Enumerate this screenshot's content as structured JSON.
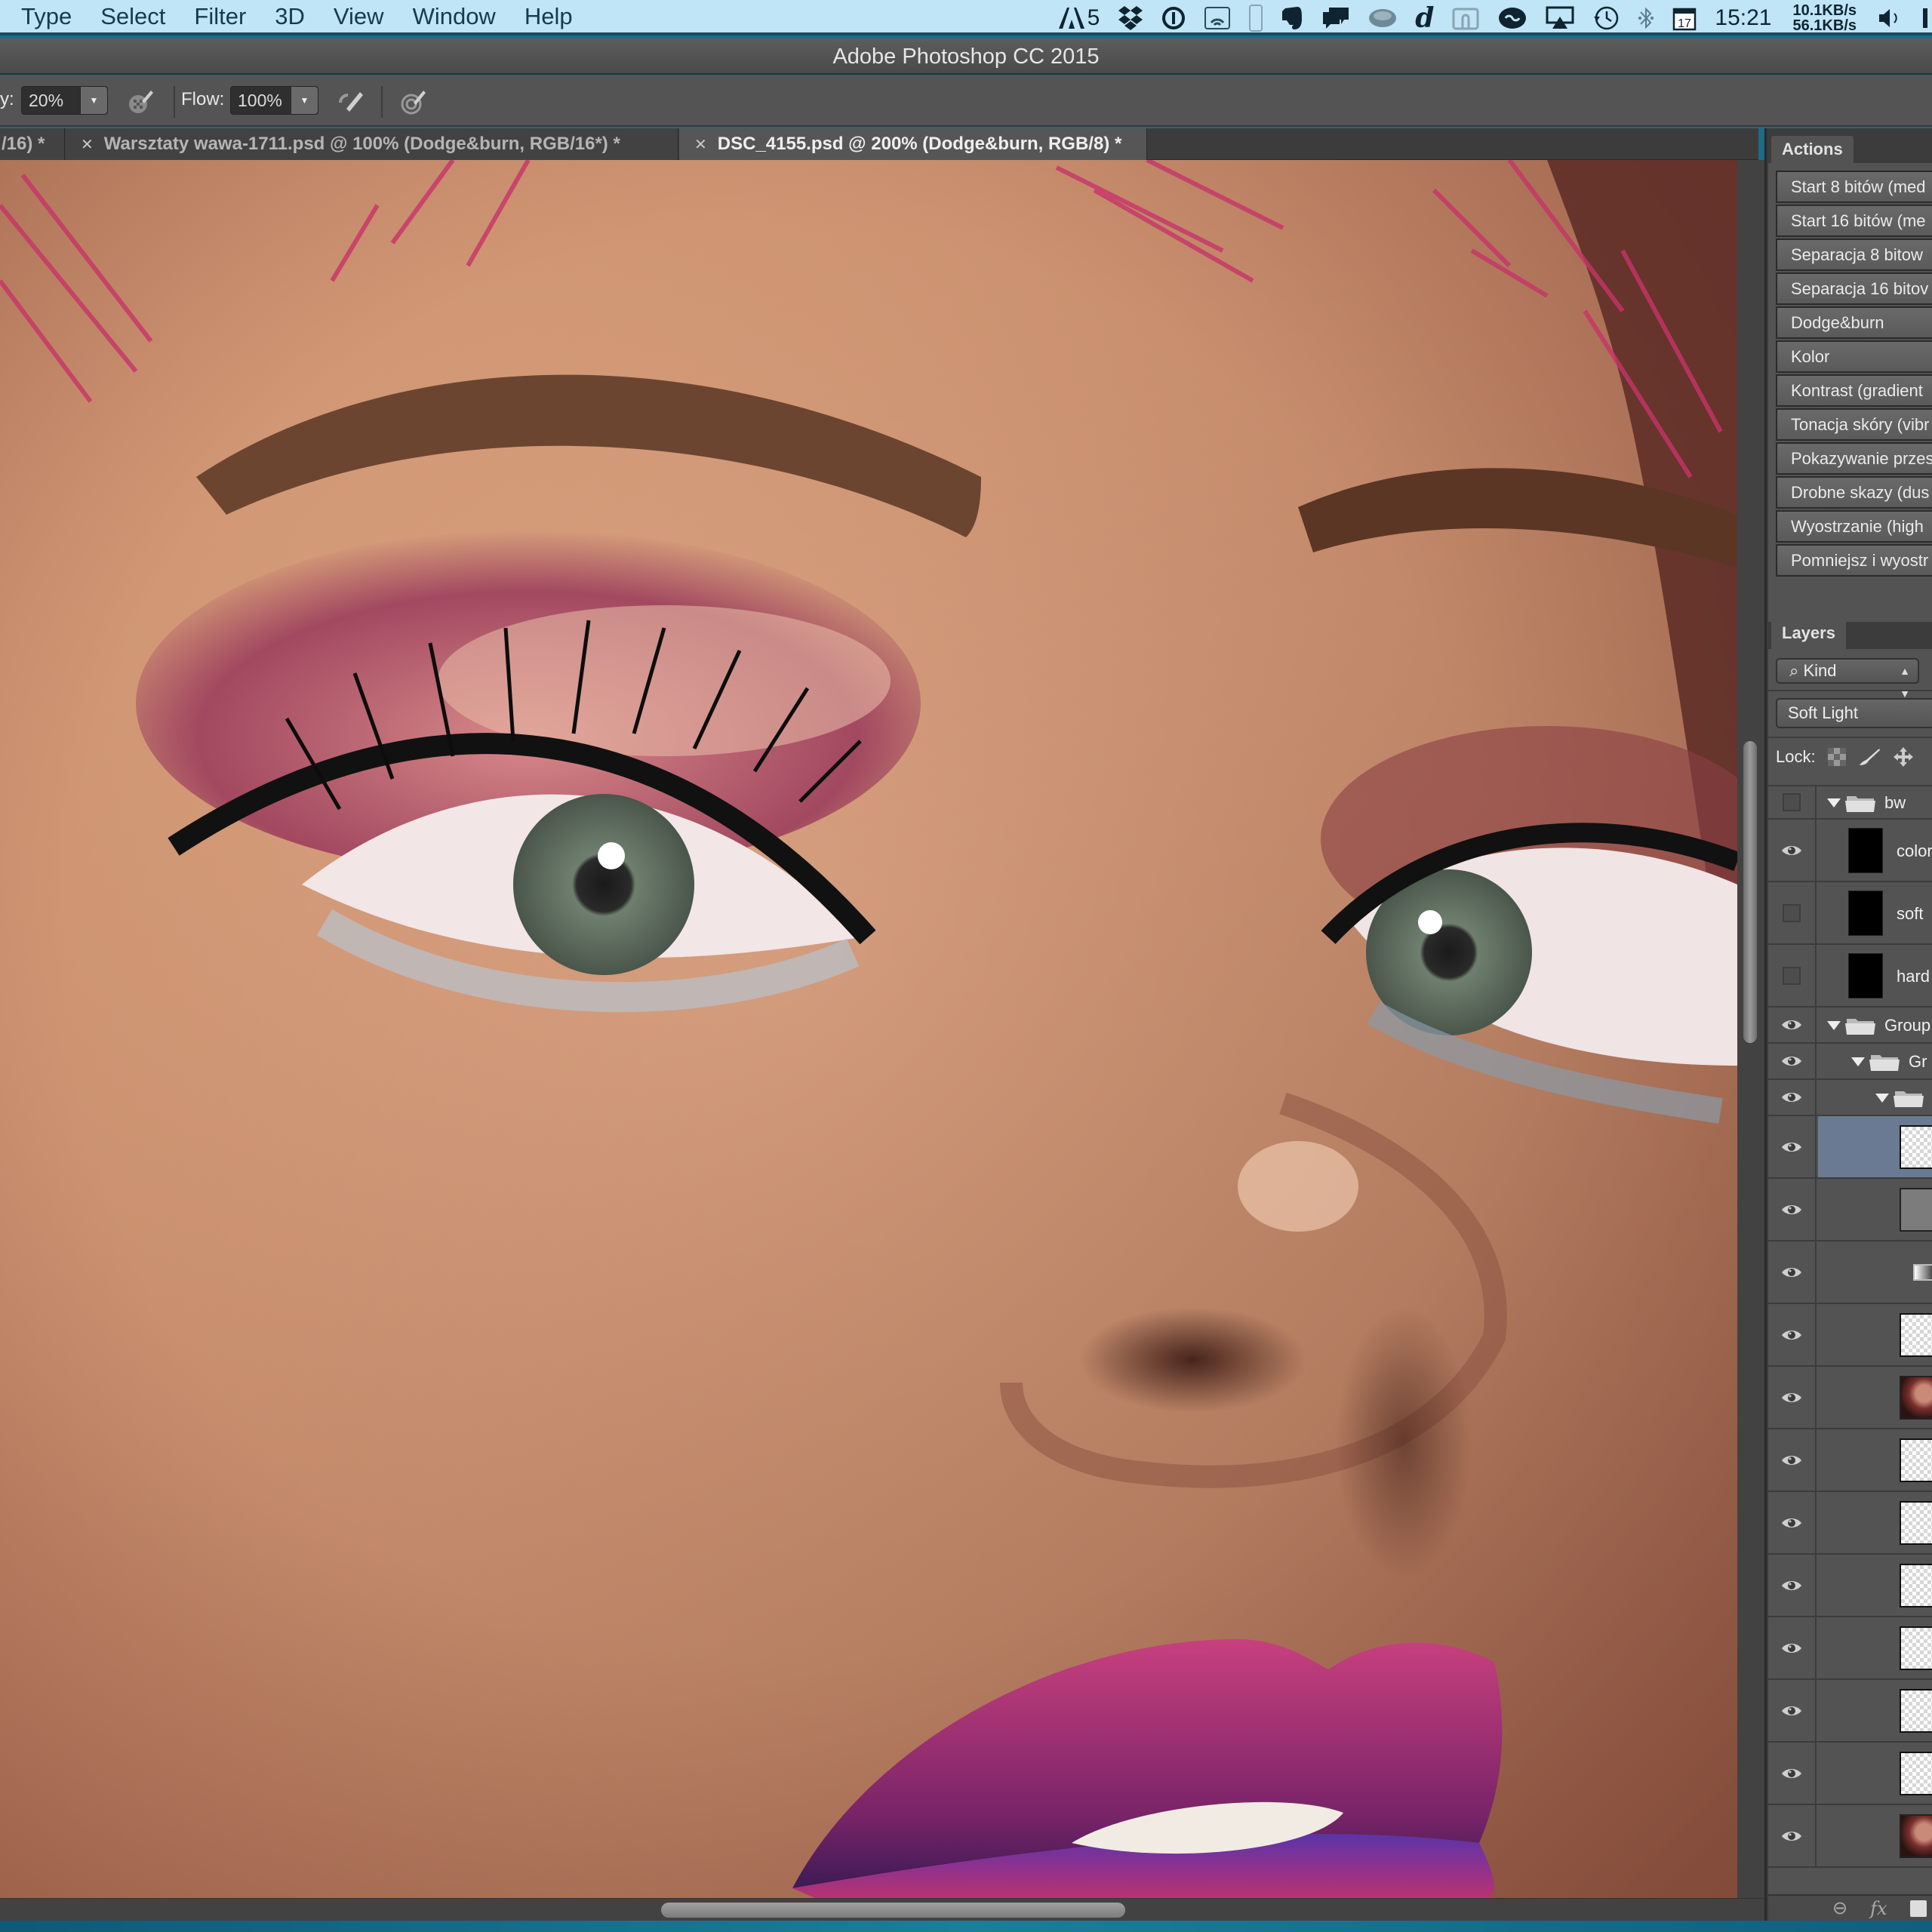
{
  "menubar": {
    "menus": [
      "Type",
      "Select",
      "Filter",
      "3D",
      "View",
      "Window",
      "Help"
    ],
    "status": {
      "adobe_badge_count": "5",
      "clock": "15:21",
      "calendar_day": "17",
      "net_up": "10.1KB/s",
      "net_down": "56.1KB/s",
      "icons": [
        "adobe-icon",
        "dropbox-icon",
        "1password-icon",
        "wifi-hotspot-icon",
        "phone-icon",
        "evernote-icon",
        "messages-icon",
        "helmet-icon",
        "dictionary-icon",
        "drive-icon",
        "creative-cloud-icon",
        "airplay-icon",
        "time-machine-icon",
        "bluetooth-icon",
        "calendar-icon",
        "volume-icon"
      ]
    }
  },
  "titlebar": {
    "title": "Adobe Photoshop CC 2015"
  },
  "options": {
    "opacity_label": "y:",
    "opacity_value": "20%",
    "flow_label": "Flow:",
    "flow_value": "100%"
  },
  "tabs": [
    {
      "label": "/16) *",
      "active": false
    },
    {
      "label": "Warsztaty wawa-1711.psd @ 100% (Dodge&burn, RGB/16*) *",
      "active": false
    },
    {
      "label": "DSC_4155.psd @ 200% (Dodge&burn, RGB/8) *",
      "active": true
    }
  ],
  "actions_panel": {
    "title": "Actions",
    "items": [
      "Start 8 bitów (med",
      "Start 16 bitów (me",
      "Separacja 8 bitow",
      "Separacja 16 bitov",
      "Dodge&burn",
      "Kolor",
      "Kontrast (gradient",
      "Tonacja skóry (vibr",
      "Pokazywanie przes",
      "Drobne skazy (dus",
      "Wyostrzanie (high",
      "Pomniejsz i wyostr"
    ]
  },
  "layers_panel": {
    "title": "Layers",
    "filter_label": "Kind",
    "blend_mode": "Soft Light",
    "lock_label": "Lock:",
    "layers": [
      {
        "name": "bw",
        "type": "group",
        "visible": false,
        "indent": 0
      },
      {
        "name": "color",
        "type": "black",
        "visible": true,
        "indent": 1
      },
      {
        "name": "soft",
        "type": "black",
        "visible": false,
        "indent": 1
      },
      {
        "name": "hard",
        "type": "black",
        "visible": false,
        "indent": 1
      },
      {
        "name": "Group",
        "type": "group",
        "visible": true,
        "indent": 0
      },
      {
        "name": "Gr",
        "type": "group",
        "visible": true,
        "indent": 1
      },
      {
        "name": "",
        "type": "group",
        "visible": true,
        "indent": 2
      },
      {
        "name": "",
        "type": "check",
        "visible": true,
        "selected": true
      },
      {
        "name": "",
        "type": "gray",
        "visible": true
      },
      {
        "name": "",
        "type": "adjustment",
        "visible": true
      },
      {
        "name": "",
        "type": "check",
        "visible": true
      },
      {
        "name": "",
        "type": "photo",
        "visible": true
      },
      {
        "name": "",
        "type": "check",
        "visible": true
      },
      {
        "name": "",
        "type": "check",
        "visible": true
      },
      {
        "name": "",
        "type": "check",
        "visible": true
      },
      {
        "name": "",
        "type": "check",
        "visible": true
      },
      {
        "name": "",
        "type": "check",
        "visible": true
      },
      {
        "name": "",
        "type": "check",
        "visible": true
      },
      {
        "name": "",
        "type": "photo",
        "visible": true
      }
    ]
  },
  "canvas": {
    "description": "Close-up beauty retouch of a woman's face with pink eyeshadow and purple-magenta ombre lips"
  }
}
